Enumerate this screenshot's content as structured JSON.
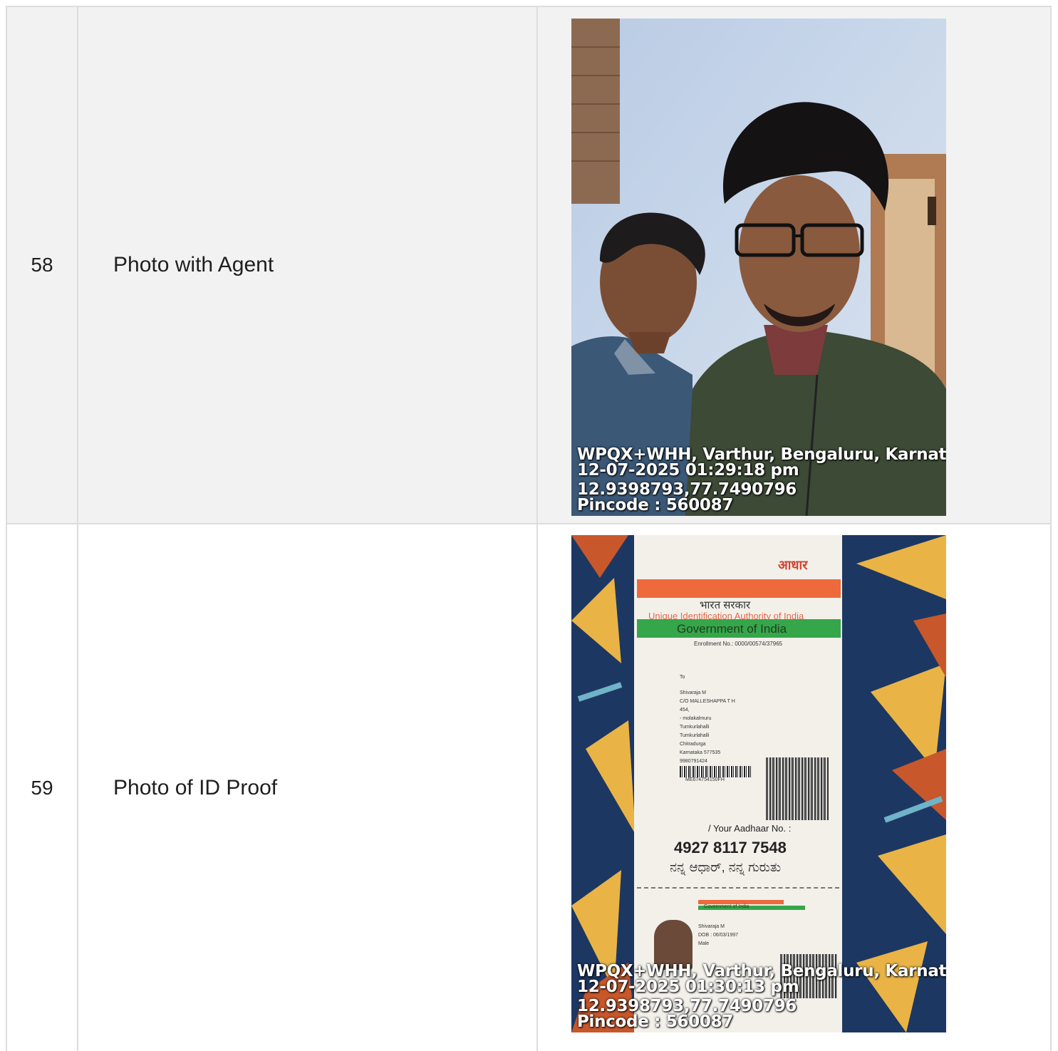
{
  "rows": [
    {
      "number": "58",
      "label": "Photo with Agent",
      "stamp": {
        "address": "WPQX+WHH, Varthur, Bengaluru, Karnataka",
        "datetime": "12-07-2025 01:29:18 pm",
        "coordinates": "12.9398793,77.7490796",
        "pincode": "Pincode : 560087"
      }
    },
    {
      "number": "59",
      "label": "Photo of ID Proof",
      "stamp": {
        "address": "WPQX+WHH, Varthur, Bengaluru, Karnataka",
        "datetime": "12-07-2025 01:30:13 pm",
        "coordinates": "12.9398793,77.7490796",
        "pincode": "Pincode : 560087"
      },
      "card": {
        "logo_text": "आधार",
        "gov_hindi": "भारत सरकार",
        "authority": "Unique Identification Authority of India",
        "government": "Government of India",
        "enrolment": "Enrollment No.: 0000/00574/37965",
        "to": "To",
        "name": "Shivaraja M",
        "care_of": "C/O MALLESHAPPA T H",
        "house": "454,",
        "locality": "- molakalmuru",
        "village1": "Tumkurlahalli",
        "village2": "Tumkurlahalli",
        "district": "Chitradurga",
        "state": "Karnataka 577535",
        "phone": "9980791424",
        "serial": "ME674754150FH",
        "your_no": "/ Your Aadhaar No. :",
        "aadhaar_number": "4927  8117  7548",
        "slogan": "ನನ್ನ ಆಧಾರ್, ನನ್ನ ಗುರುತು",
        "small_gov": "Government of India",
        "small_name": "Shivaraja M",
        "dob": "DOB : 06/03/1997",
        "gender": "Male"
      }
    }
  ]
}
